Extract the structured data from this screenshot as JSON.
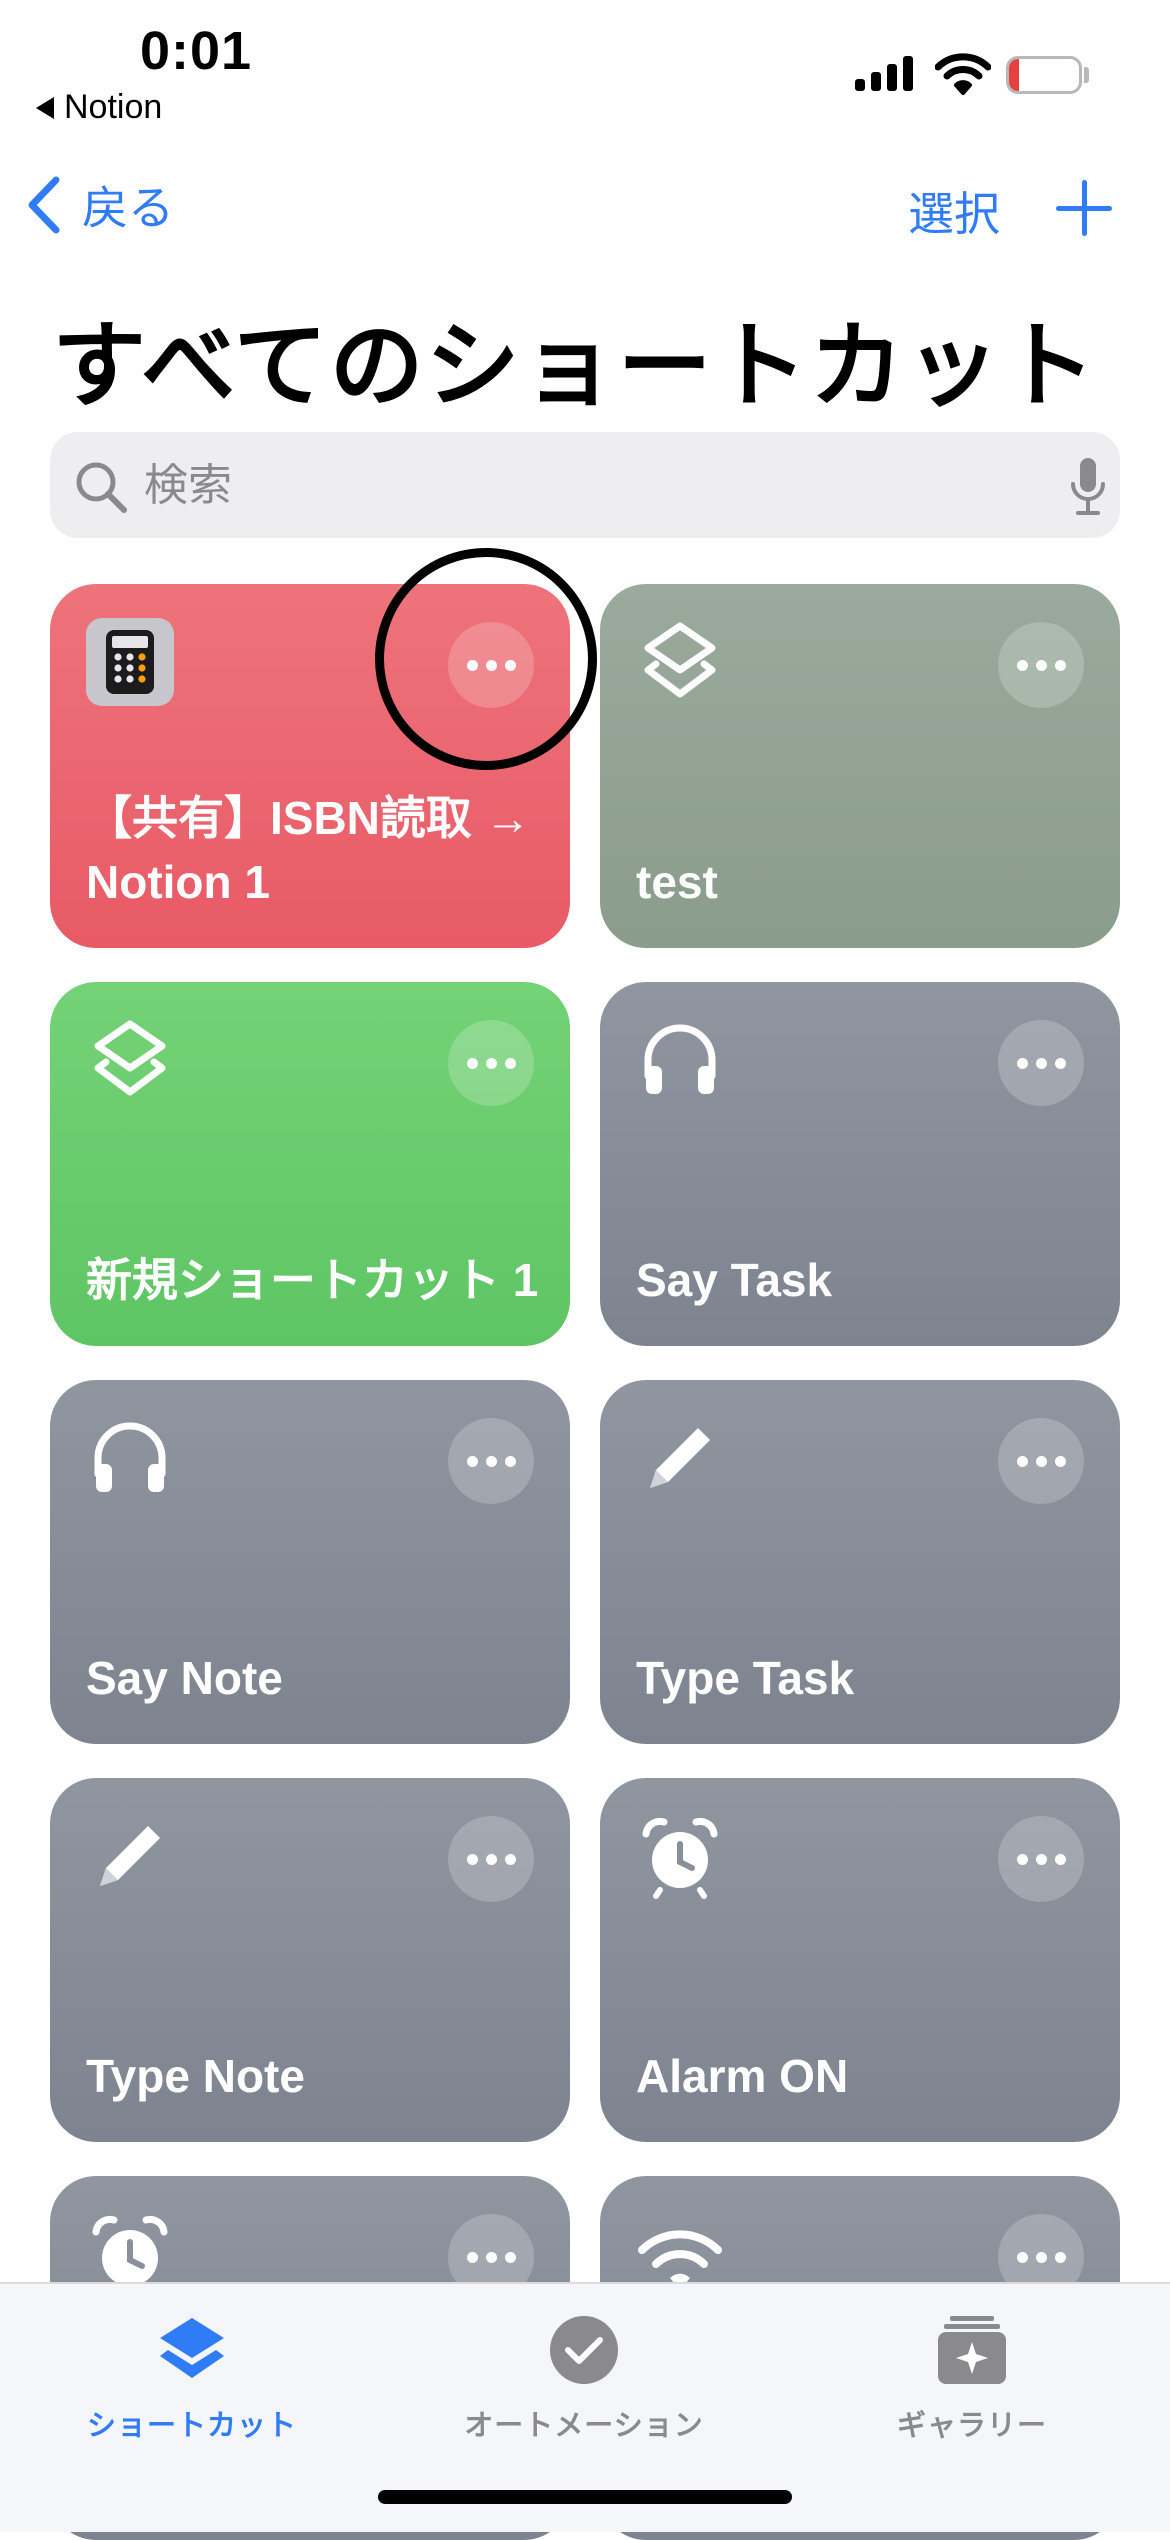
{
  "status_bar": {
    "time": "0:01",
    "back_app": "Notion",
    "battery_level": "4",
    "battery_fraction": 0.04
  },
  "nav": {
    "back_label": "戻る",
    "select_label": "選択",
    "add_icon": "plus-icon"
  },
  "page": {
    "title": "すべてのショートカット"
  },
  "search": {
    "placeholder": "検索"
  },
  "shortcuts": [
    {
      "title": "【共有】ISBN読取 → Notion 1",
      "icon": "calculator-icon",
      "color": "#ea6470"
    },
    {
      "title": "test",
      "icon": "shortcuts-layers-icon",
      "color": "#93a394"
    },
    {
      "title": "新規ショートカット 1",
      "icon": "shortcuts-layers-icon",
      "color": "#67cb6b"
    },
    {
      "title": "Say Task",
      "icon": "headphones-icon",
      "color": "#878d97"
    },
    {
      "title": "Say Note",
      "icon": "headphones-icon",
      "color": "#878d97"
    },
    {
      "title": "Type Task",
      "icon": "pencil-icon",
      "color": "#878d97"
    },
    {
      "title": "Type Note",
      "icon": "pencil-icon",
      "color": "#878d97"
    },
    {
      "title": "Alarm ON",
      "icon": "alarm-clock-icon",
      "color": "#878d97"
    },
    {
      "title": "",
      "icon": "alarm-clock-icon",
      "color": "#878d97"
    },
    {
      "title": "",
      "icon": "wifi-icon",
      "color": "#878d97"
    }
  ],
  "tabs": [
    {
      "label": "ショートカット",
      "icon": "shortcuts-layers-icon",
      "active": true
    },
    {
      "label": "オートメーション",
      "icon": "checkmark-circle-icon",
      "active": false
    },
    {
      "label": "ギャラリー",
      "icon": "gallery-sparkle-icon",
      "active": false
    }
  ],
  "colors": {
    "accent": "#2f7cf6",
    "annotation_ring": "#000000"
  }
}
